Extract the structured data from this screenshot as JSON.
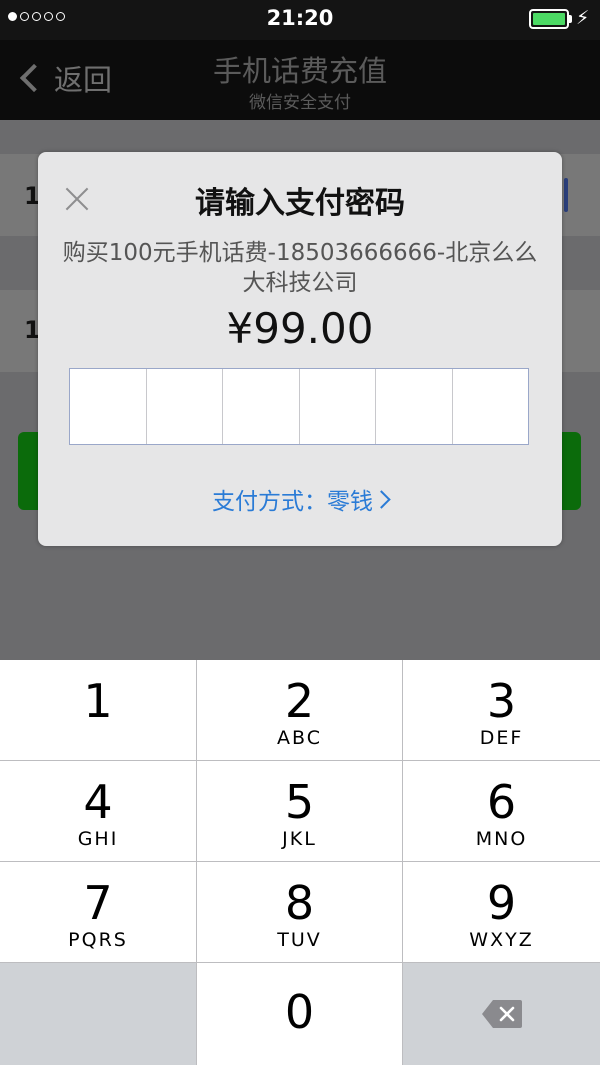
{
  "status_bar": {
    "time": "21:20",
    "signal_dots": [
      true,
      false,
      false,
      false,
      false
    ],
    "battery_color": "#4cd964",
    "icons": [
      "signal-dots-icon",
      "battery-icon",
      "charging-bolt-icon"
    ]
  },
  "nav": {
    "back_label": "返回",
    "title": "手机话费充值",
    "subtitle": "微信安全支付"
  },
  "background_rows": [
    {
      "label": "1"
    },
    {
      "label": "1"
    }
  ],
  "dialog": {
    "title": "请输入支付密码",
    "description": "购买100元手机话费-18503666666-北京么么大科技公司",
    "amount": "¥99.00",
    "password_length": 6,
    "payment_method": "支付方式：零钱",
    "accent_color": "#2a7bd6"
  },
  "keypad": {
    "keys": [
      {
        "num": "1",
        "letters": ""
      },
      {
        "num": "2",
        "letters": "ABC"
      },
      {
        "num": "3",
        "letters": "DEF"
      },
      {
        "num": "4",
        "letters": "GHI"
      },
      {
        "num": "5",
        "letters": "JKL"
      },
      {
        "num": "6",
        "letters": "MNO"
      },
      {
        "num": "7",
        "letters": "PQRS"
      },
      {
        "num": "8",
        "letters": "TUV"
      },
      {
        "num": "9",
        "letters": "WXYZ"
      },
      {
        "num": "0",
        "letters": ""
      }
    ]
  }
}
